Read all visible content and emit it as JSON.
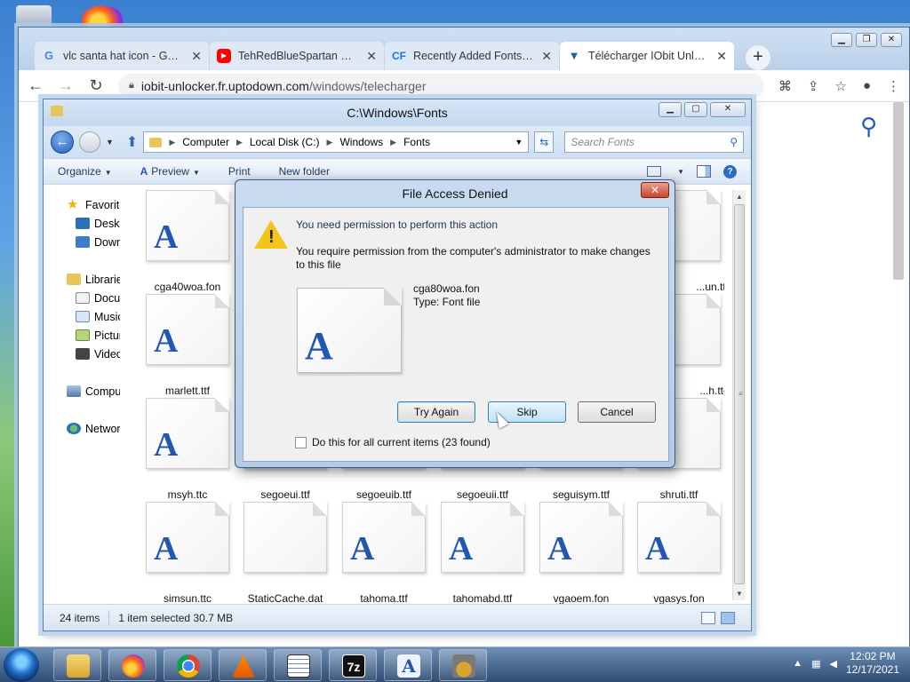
{
  "browser": {
    "tabs": [
      {
        "favicon": "google-icon",
        "title": "vlc santa hat icon - Google"
      },
      {
        "favicon": "youtube-icon",
        "title": "TehRedBlueSpartan Nomi"
      },
      {
        "favicon": "cf-icon",
        "title": "Recently Added Fonts Fon"
      },
      {
        "favicon": "uptodown-icon",
        "title": "Télécharger IObit Unlocke"
      }
    ],
    "url_host": "iobit-unlocker.fr.uptodown.com",
    "url_path": "/windows/telecharger"
  },
  "explorer": {
    "title": "C:\\Windows\\Fonts",
    "breadcrumb": [
      "Computer",
      "Local Disk (C:)",
      "Windows",
      "Fonts"
    ],
    "search_placeholder": "Search Fonts",
    "commands": {
      "organize": "Organize",
      "preview": "Preview",
      "print": "Print",
      "new_folder": "New folder"
    },
    "nav": [
      {
        "label": "Favorites",
        "icon": "star-icon",
        "level": 1
      },
      {
        "label": "Desktop",
        "icon": "desktop-icon",
        "level": 2
      },
      {
        "label": "Downloads",
        "icon": "downloads-icon",
        "level": 2
      },
      {
        "gap": true
      },
      {
        "label": "Libraries",
        "icon": "library-icon",
        "level": 1
      },
      {
        "label": "Documents",
        "icon": "documents-icon",
        "level": 2
      },
      {
        "label": "Music",
        "icon": "music-icon",
        "level": 2
      },
      {
        "label": "Pictures",
        "icon": "pictures-icon",
        "level": 2
      },
      {
        "label": "Videos",
        "icon": "videos-icon",
        "level": 2
      },
      {
        "gap": true
      },
      {
        "label": "Computer",
        "icon": "computer-icon",
        "level": 1
      },
      {
        "gap": true
      },
      {
        "label": "Network",
        "icon": "network-icon",
        "level": 1
      }
    ],
    "files": [
      {
        "name": "cga40woa.fon",
        "font": true
      },
      {
        "name": "",
        "font": true
      },
      {
        "name": "",
        "font": true
      },
      {
        "name": "",
        "font": true
      },
      {
        "name": "",
        "font": true
      },
      {
        "name": "...un.ttf",
        "font": true
      },
      {
        "name": "marlett.ttf",
        "font": true
      },
      {
        "name": "",
        "font": true
      },
      {
        "name": "",
        "font": true
      },
      {
        "name": "",
        "font": true
      },
      {
        "name": "",
        "font": true
      },
      {
        "name": "...h.ttc",
        "font": true
      },
      {
        "name": "msyh.ttc",
        "font": true
      },
      {
        "name": "segoeui.ttf",
        "font": true
      },
      {
        "name": "segoeuib.ttf",
        "font": true
      },
      {
        "name": "segoeuii.ttf",
        "font": true
      },
      {
        "name": "seguisym.ttf",
        "font": true
      },
      {
        "name": "shruti.ttf",
        "font": true
      },
      {
        "name": "simsun.ttc",
        "font": true
      },
      {
        "name": "StaticCache.dat",
        "font": false
      },
      {
        "name": "tahoma.ttf",
        "font": true
      },
      {
        "name": "tahomabd.ttf",
        "font": true
      },
      {
        "name": "vgaoem.fon",
        "font": true
      },
      {
        "name": "vgasys.fon",
        "font": true
      }
    ],
    "status": {
      "count": "24 items",
      "selection": "1 item selected  30.7 MB"
    }
  },
  "dialog": {
    "title": "File Access Denied",
    "main": "You need permission to perform this action",
    "sub": "You require permission from the computer's administrator to make changes to this file",
    "file_name": "cga80woa.fon",
    "file_type": "Type: Font file",
    "buttons": {
      "try_again": "Try Again",
      "skip": "Skip",
      "cancel": "Cancel"
    },
    "checkbox_label": "Do this for all current items (23 found)"
  },
  "taskbar": {
    "time": "12:02 PM",
    "date": "12/17/2021",
    "apps": [
      "explorer",
      "firefox",
      "chrome",
      "vlc",
      "notepad",
      "7zip",
      "font-viewer",
      "iobit-unlocker"
    ]
  },
  "colors": {
    "accent_blue": "#2356b2",
    "warning_yellow": "#f3c51a",
    "close_red": "#c8452b"
  }
}
